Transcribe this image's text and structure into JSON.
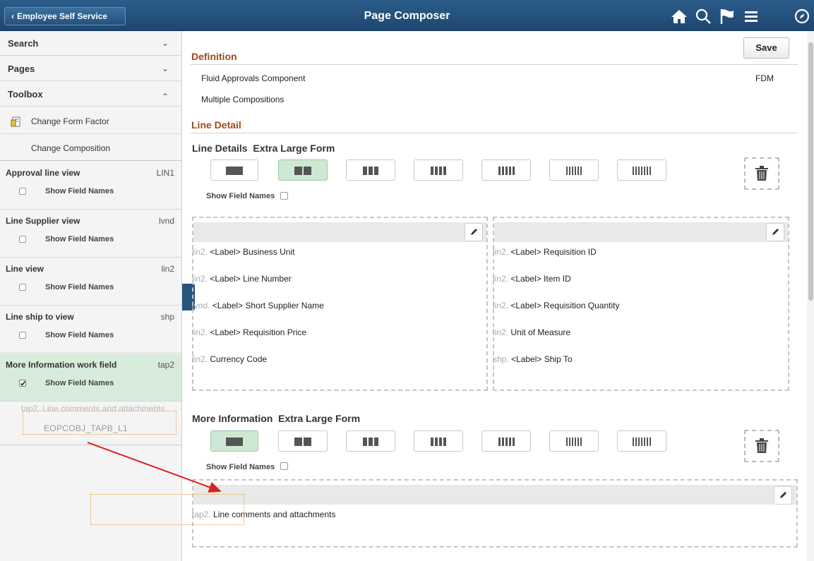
{
  "header": {
    "back_label": "Employee Self Service",
    "title": "Page Composer"
  },
  "sidebar": {
    "accordions": [
      {
        "label": "Search",
        "caret": "⌄"
      },
      {
        "label": "Pages",
        "caret": "⌄"
      },
      {
        "label": "Toolbox",
        "caret": "⌃"
      }
    ],
    "toolbox": {
      "change_form_factor": "Change Form Factor",
      "change_composition": "Change Composition"
    },
    "sections": [
      {
        "name": "Approval line view",
        "code": "LIN1",
        "show_field_names": "Show Field Names",
        "checked": false
      },
      {
        "name": "Line Supplier view",
        "code": "lvnd",
        "show_field_names": "Show Field Names",
        "checked": false
      },
      {
        "name": "Line view",
        "code": "lin2",
        "show_field_names": "Show Field Names",
        "checked": false
      },
      {
        "name": "Line ship to view",
        "code": "shp",
        "show_field_names": "Show Field Names",
        "checked": false
      },
      {
        "name": "More Information work field",
        "code": "tap2",
        "show_field_names": "Show Field Names",
        "checked": true
      }
    ],
    "drag": {
      "label": "tap2. Line comments and attachments",
      "object": "EOPCOBJ_TAPB_L1"
    }
  },
  "main": {
    "save_label": "Save",
    "definition": {
      "heading": "Definition",
      "component": "Fluid Approvals Component",
      "code": "FDM",
      "compositions": "Multiple Compositions"
    },
    "line_detail": {
      "heading": "Line Detail",
      "subheading": "Line Details  Extra Large Form",
      "show_field_names": "Show Field Names",
      "col1": [
        {
          "prefix": "lin2.",
          "text": "<Label> Business Unit"
        },
        {
          "prefix": "lin2.",
          "text": "<Label> Line Number"
        },
        {
          "prefix": "lvnd.",
          "text": "<Label> Short Supplier Name"
        },
        {
          "prefix": "lin2.",
          "text": "<Label> Requisition Price"
        },
        {
          "prefix": "lin2.",
          "text": "Currency Code"
        }
      ],
      "col2": [
        {
          "prefix": "lin2.",
          "text": "<Label> Requisition ID"
        },
        {
          "prefix": "lin2.",
          "text": "<Label> Item ID"
        },
        {
          "prefix": "lin2.",
          "text": "<Label> Requisition Quantity"
        },
        {
          "prefix": "lin2.",
          "text": "Unit of Measure"
        },
        {
          "prefix": "shp.",
          "text": "<Label> Ship To"
        }
      ]
    },
    "more_info": {
      "subheading": "More Information  Extra Large Form",
      "show_field_names": "Show Field Names",
      "col1": [
        {
          "prefix": "tap2.",
          "text": "Line comments and attachments"
        }
      ]
    }
  },
  "colors": {
    "header": "#24527e",
    "section_heading": "#9b4a1b",
    "selected": "#cfe8d4"
  }
}
